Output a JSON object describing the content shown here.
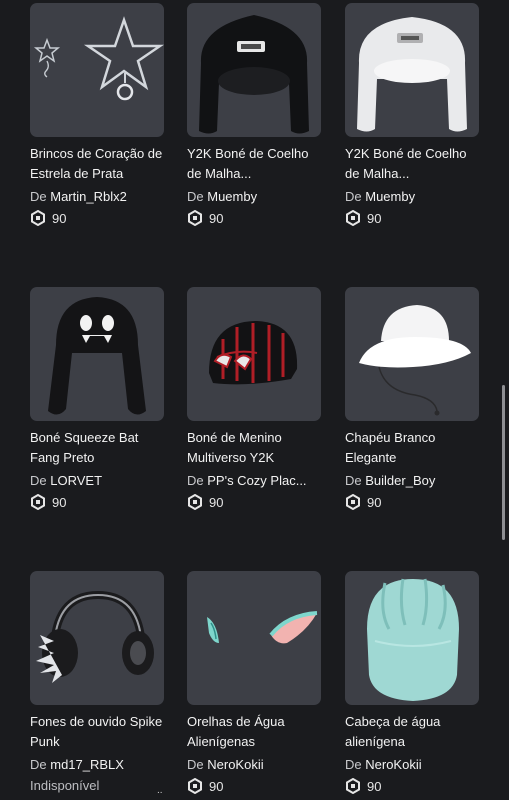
{
  "items": [
    {
      "name": "Brincos de Coração de Estrela de Prata",
      "creator_prefix": "De",
      "creator": "Martin_Rblx2",
      "price": "90",
      "icon": "star-earrings-icon"
    },
    {
      "name": "Y2K Boné de Coelho de Malha...",
      "creator_prefix": "De",
      "creator": "Muemby",
      "price": "90",
      "icon": "black-bunny-knit-hat-icon"
    },
    {
      "name": "Y2K Boné de Coelho de Malha...",
      "creator_prefix": "De",
      "creator": "Muemby",
      "price": "90",
      "icon": "white-bunny-knit-hat-icon"
    },
    {
      "name": "Boné Squeeze Bat Fang Preto",
      "creator_prefix": "De",
      "creator": "LORVET",
      "price": "90",
      "icon": "bat-fang-hat-icon"
    },
    {
      "name": "Boné de Menino Multiverso Y2K",
      "creator_prefix": "De",
      "creator": "PP's Cozy Plac...",
      "price": "90",
      "icon": "spider-beanie-icon"
    },
    {
      "name": "Chapéu Branco Elegante",
      "creator_prefix": "De",
      "creator": "Builder_Boy",
      "price": "90",
      "icon": "white-bucket-hat-icon"
    },
    {
      "name": "Fones de ouvido Spike Punk",
      "creator_prefix": "De",
      "creator": "md17_RBLX",
      "status": "Indisponível",
      "icon": "spike-headphones-icon"
    },
    {
      "name": "Orelhas de Água Alienígenas",
      "creator_prefix": "De",
      "creator": "NeroKokii",
      "price": "90",
      "icon": "alien-ears-icon"
    },
    {
      "name": "Cabeça de água alienígena",
      "creator_prefix": "De",
      "creator": "NeroKokii",
      "price": "90",
      "icon": "alien-head-icon"
    }
  ],
  "currency_icon": "robux-icon",
  "footer_dots": ".."
}
